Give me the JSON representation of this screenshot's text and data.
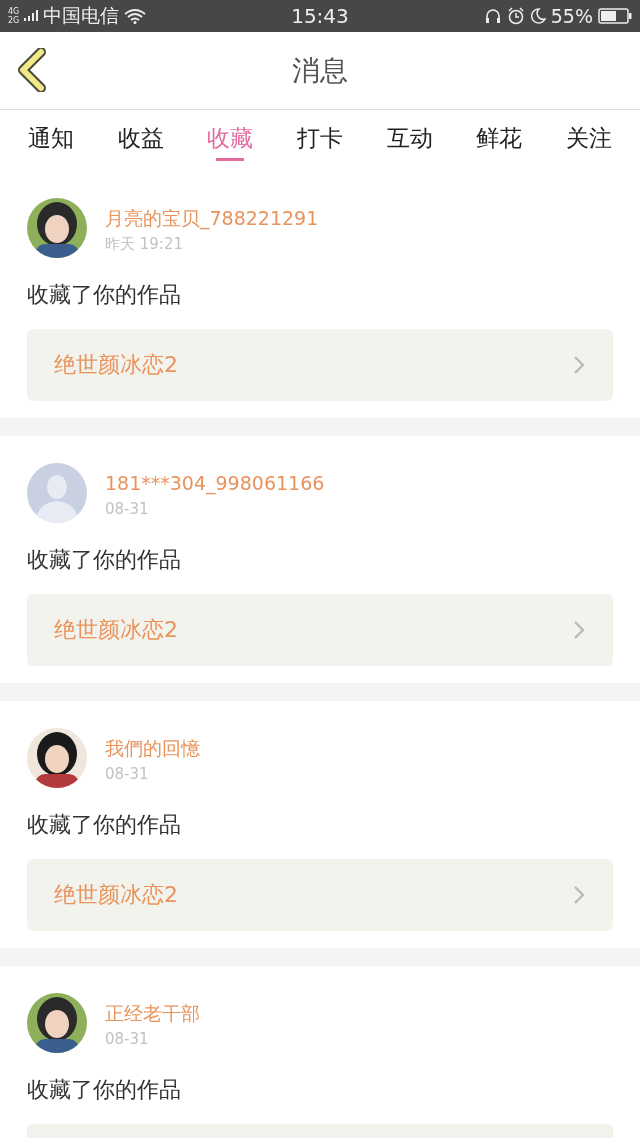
{
  "status_bar": {
    "network_top": "4G",
    "network_bottom": "2G",
    "carrier": "中国电信",
    "time": "15:43",
    "battery": "55%"
  },
  "header": {
    "title": "消息"
  },
  "tabs": [
    {
      "label": "通知",
      "selected": false
    },
    {
      "label": "收益",
      "selected": false
    },
    {
      "label": "收藏",
      "selected": true
    },
    {
      "label": "打卡",
      "selected": false
    },
    {
      "label": "互动",
      "selected": false
    },
    {
      "label": "鲜花",
      "selected": false
    },
    {
      "label": "关注",
      "selected": false
    }
  ],
  "messages": [
    {
      "name": "月亮的宝贝_788221291",
      "time": "昨天 19:21",
      "text": "收藏了你的作品",
      "work_title": "绝世颜冰恋2"
    },
    {
      "avatar": {
        "kind": "default"
      },
      "name": "181***304_998061166",
      "time": "08-31",
      "text": "收藏了你的作品",
      "work_title": "绝世颜冰恋2"
    },
    {
      "name": "我們的回憶",
      "time": "08-31",
      "text": "收藏了你的作品",
      "work_title": "绝世颜冰恋2"
    },
    {
      "name": "正经老干部",
      "time": "08-31",
      "text": "收藏了你的作品"
    }
  ]
}
